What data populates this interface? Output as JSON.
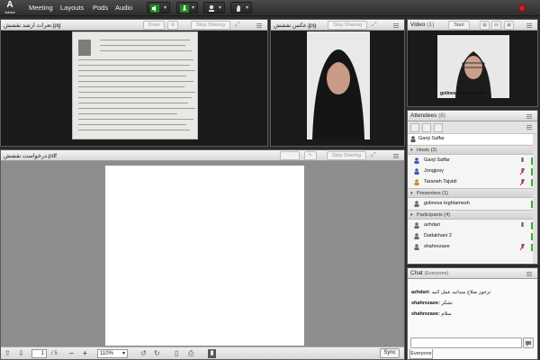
{
  "app": {
    "logo_letter": "A",
    "logo_text": "Adobe"
  },
  "menu": [
    "Meeting",
    "Layouts",
    "Pods",
    "Audio"
  ],
  "toolbar": {
    "buttons": [
      "speaker-icon",
      "microphone-icon",
      "webcam-icon",
      "raise-hand-icon"
    ],
    "record_color": "#d81e1e"
  },
  "pod1": {
    "title": "تعرات ارشد نقشش.jpg",
    "draw": "Draw",
    "stop_sharing": "Stop Sharing"
  },
  "pod2": {
    "title": "عکس نقشش.jpg",
    "stop_sharing": "Stop Sharing"
  },
  "video": {
    "title": "Video",
    "count": "(1)",
    "start": "Start",
    "camera_name": "golinesa toghtamesh"
  },
  "pdf": {
    "title": "درخواست نقشش.pdf",
    "stop_sharing": "Stop Sharing",
    "page": "1",
    "of": "/ 5",
    "zoom": "110%",
    "sync": "Sync"
  },
  "attendees": {
    "title": "Attendees",
    "count": "(8)",
    "me": "Ganji Saffar",
    "hosts_label": "Hosts (3)",
    "hosts": [
      "Ganji Saffar",
      "Jongjooy",
      "Taraneh Tajvidi"
    ],
    "presenters_label": "Presenters (1)",
    "presenters": [
      "golinesa toghtamesh"
    ],
    "participants_label": "Participants (4)",
    "participants": [
      "azhdari",
      "Dadakhani 2",
      "shahrezaee"
    ]
  },
  "chat": {
    "title": "Chat",
    "scope": "(Everyone)",
    "messages": [
      {
        "user": "azhdari:",
        "text": "ترجوز صلاح میدانید عمل کنید"
      },
      {
        "user": "shahrezaee:",
        "text": "تشکر"
      },
      {
        "user": "shahrezaee:",
        "text": "سلام"
      }
    ],
    "tab": "Everyone"
  }
}
